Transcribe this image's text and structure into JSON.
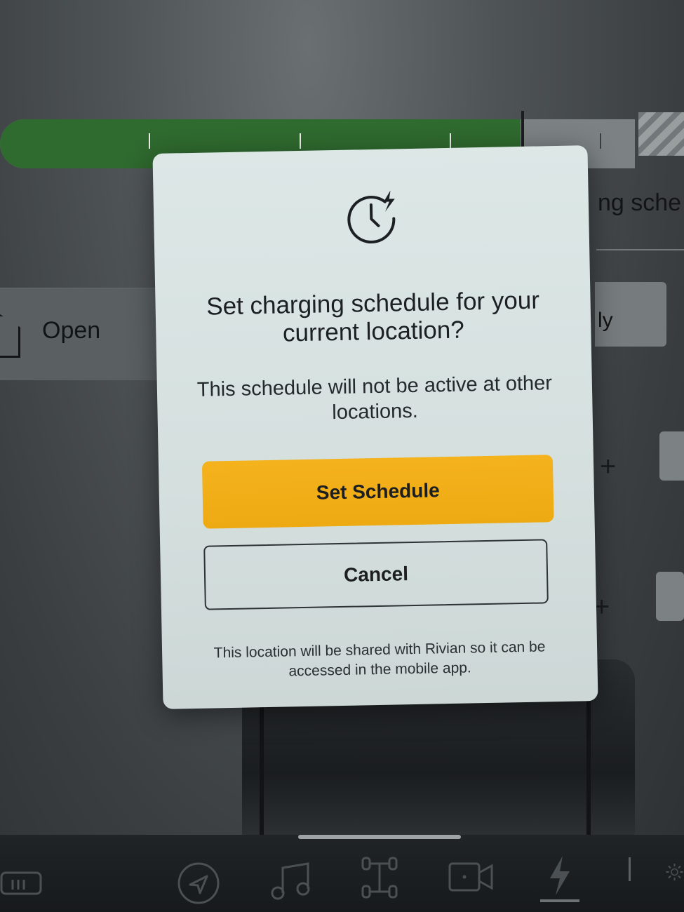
{
  "background": {
    "left_panel": {
      "label": "Open",
      "icon": "house-icon"
    },
    "right_title_fragment": "ng sche",
    "right_chip_fragment": "ly",
    "charge_bar": {
      "fill_fraction": 0.82,
      "limit_fraction": 0.82,
      "fill_color": "#2f6a2f"
    }
  },
  "modal": {
    "icon": "clock-bolt-icon",
    "title": "Set charging schedule for your current location?",
    "body": "This schedule will not be active at other locations.",
    "primary_button": "Set Schedule",
    "secondary_button": "Cancel",
    "footer": "This location will be shared with Rivian so it can be accessed in the mobile app.",
    "accent_color": "#f0ab14"
  },
  "dock": {
    "items": [
      {
        "name": "rear-defrost-icon"
      },
      {
        "name": "navigation-icon"
      },
      {
        "name": "music-icon"
      },
      {
        "name": "drive-modes-icon"
      },
      {
        "name": "camera-icon"
      },
      {
        "name": "energy-icon",
        "active": true
      },
      {
        "name": "settings-icon"
      }
    ]
  }
}
